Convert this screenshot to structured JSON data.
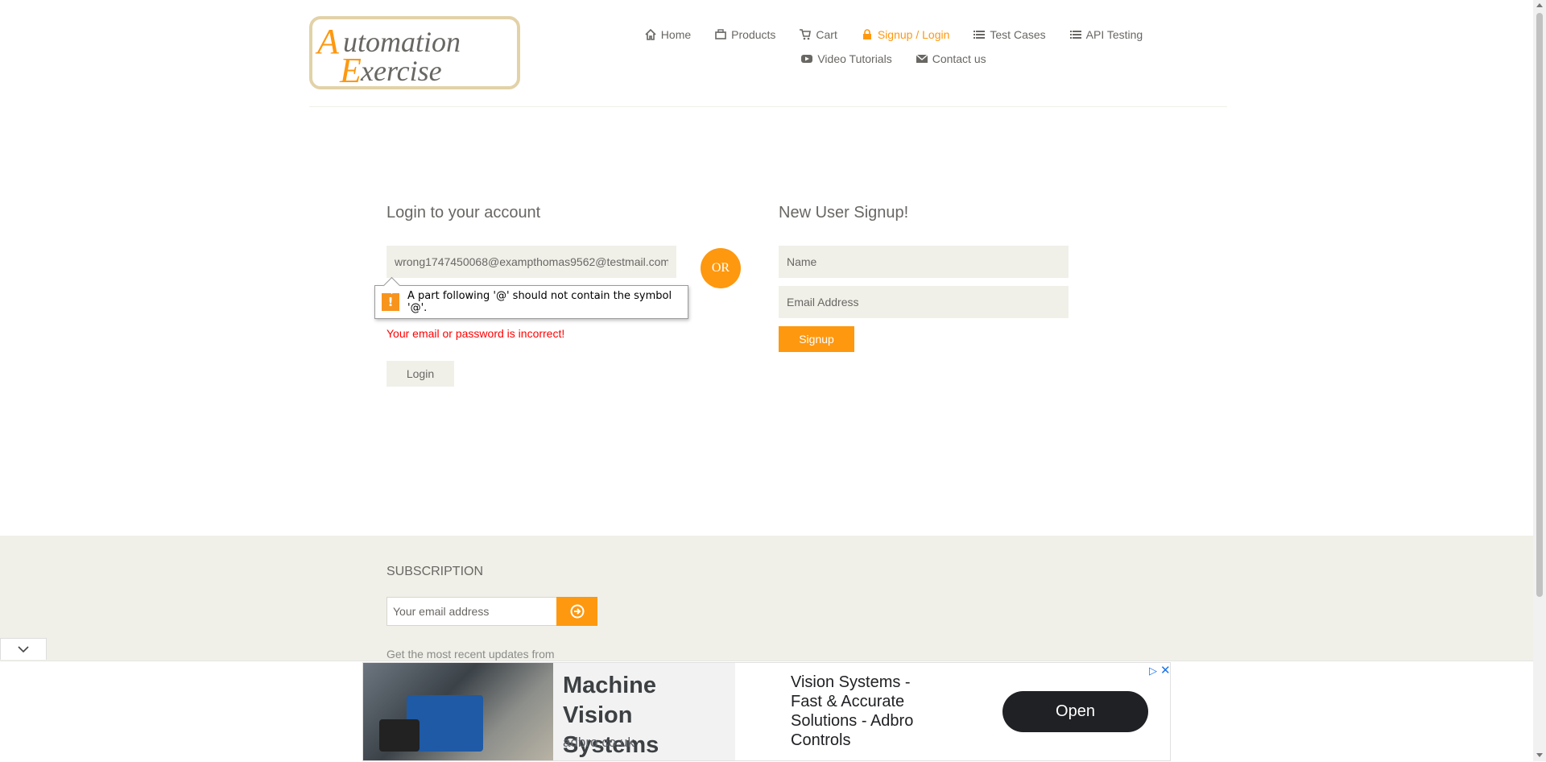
{
  "logo": {
    "line1": "Automation",
    "line2": "Exercise",
    "initial1": "A",
    "initial2": "E"
  },
  "nav": {
    "row1": [
      {
        "label": "Home",
        "icon": "home-icon",
        "active": false
      },
      {
        "label": "Products",
        "icon": "products-icon",
        "active": false
      },
      {
        "label": "Cart",
        "icon": "cart-icon",
        "active": false
      },
      {
        "label": "Signup / Login",
        "icon": "lock-icon",
        "active": true
      },
      {
        "label": "Test Cases",
        "icon": "list-icon",
        "active": false
      },
      {
        "label": "API Testing",
        "icon": "list-icon",
        "active": false
      }
    ],
    "row2": [
      {
        "label": "Video Tutorials",
        "icon": "youtube-icon",
        "active": false
      },
      {
        "label": "Contact us",
        "icon": "envelope-icon",
        "active": false
      }
    ]
  },
  "login": {
    "title": "Login to your account",
    "email_value": "wrong1747450068@exampthomas9562@testmail.com",
    "validation_message": "A part following '@' should not contain the symbol '@'.",
    "error_message": "Your email or password is incorrect!",
    "button_label": "Login"
  },
  "or_label": "OR",
  "signup": {
    "title": "New User Signup!",
    "name_placeholder": "Name",
    "email_placeholder": "Email Address",
    "button_label": "Signup"
  },
  "footer": {
    "subscription_title": "SUBSCRIPTION",
    "email_placeholder": "Your email address",
    "description": "Get the most recent updates from"
  },
  "ad": {
    "headline": "Machine Vision Systems",
    "domain": "adbro.co.uk",
    "description": "Vision Systems - Fast & Accurate Solutions - Adbro Controls",
    "button_label": "Open"
  },
  "colors": {
    "accent": "#FE980F",
    "error": "#FF0000",
    "field_bg": "#F0F0E9"
  }
}
